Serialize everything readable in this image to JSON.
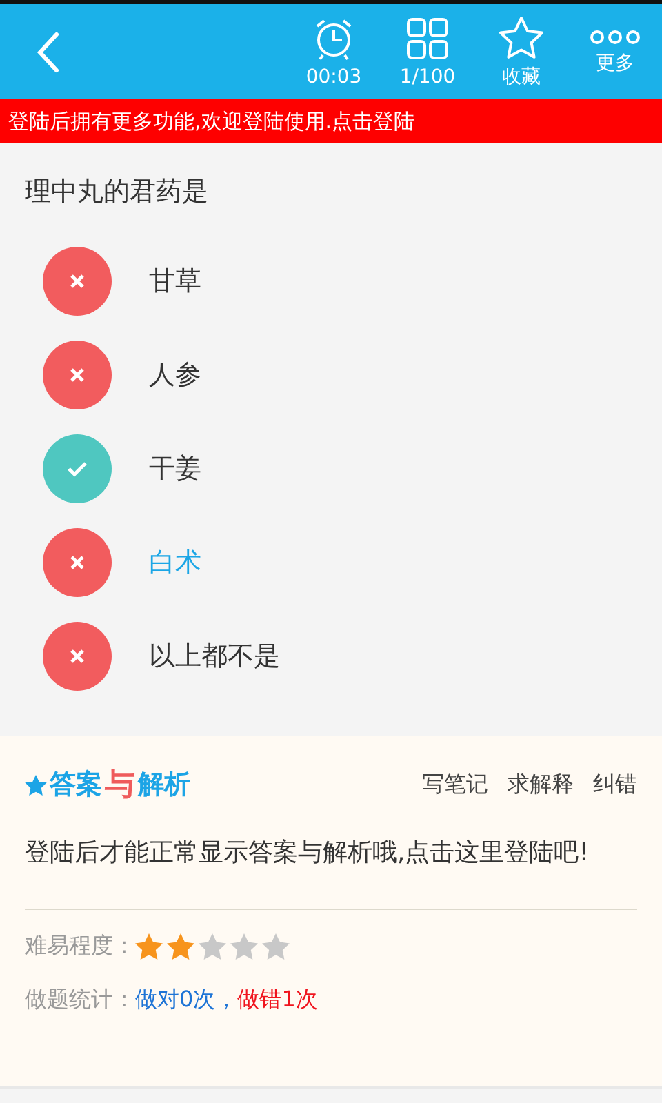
{
  "toolbar": {
    "items": [
      {
        "kind": "alarm",
        "label": "00:03"
      },
      {
        "kind": "grid",
        "label": "1/100"
      },
      {
        "kind": "star",
        "label": "收藏"
      },
      {
        "kind": "dots",
        "label": "更多"
      }
    ]
  },
  "banner": "登陆后拥有更多功能,欢迎登陆使用.点击登陆",
  "question": "理中丸的君药是",
  "options": [
    {
      "text": "甘草",
      "kind": "wrong",
      "selected": false
    },
    {
      "text": "人参",
      "kind": "wrong",
      "selected": false
    },
    {
      "text": "干姜",
      "kind": "correct",
      "selected": false
    },
    {
      "text": "白术",
      "kind": "wrong",
      "selected": true
    },
    {
      "text": "以上都不是",
      "kind": "wrong",
      "selected": false
    }
  ],
  "answer": {
    "logo": [
      {
        "text": "答案",
        "kind": "plain"
      },
      {
        "text": "与",
        "kind": "accent"
      },
      {
        "text": "解析",
        "kind": "plain"
      }
    ],
    "actions": [
      "写笔记",
      "求解释",
      "纠错"
    ],
    "message": "登陆后才能正常显示答案与解析哦,点击这里登陆吧!",
    "difficulty": {
      "label": "难易程度：",
      "stars": 2
    },
    "stats": {
      "label": "做题统计：",
      "parts": [
        {
          "text": "做对0次",
          "kind": "right"
        },
        {
          "text": "，",
          "kind": "right"
        },
        {
          "text": "做错1次",
          "kind": "wrong"
        }
      ]
    }
  }
}
